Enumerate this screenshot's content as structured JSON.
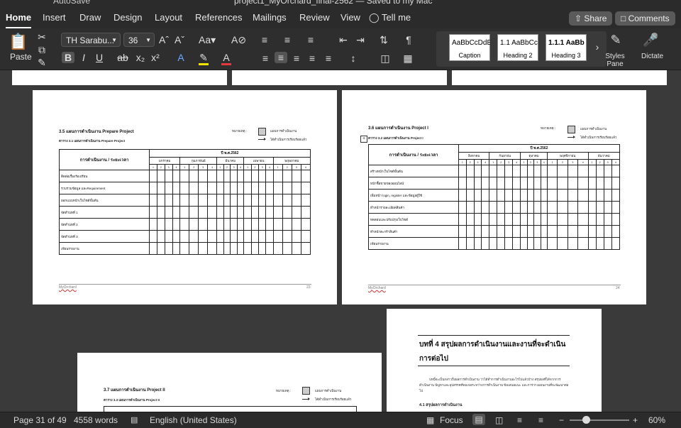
{
  "window": {
    "autosave_label": "AutoSave",
    "doc_title": "project1_MyOrchard_final-2562",
    "save_state": "— Saved to my Mac"
  },
  "tabs": [
    "Home",
    "Insert",
    "Draw",
    "Design",
    "Layout",
    "References",
    "Mailings",
    "Review",
    "View"
  ],
  "tell_me": "Tell me",
  "share_label": "Share",
  "comments_label": "Comments",
  "ribbon": {
    "paste_label": "Paste",
    "font_name": "TH Sarabu...",
    "font_size": "36",
    "styles": [
      {
        "sample": "AaBbCcDdEe",
        "name": "Caption"
      },
      {
        "sample": "1.1  AaBbCc",
        "name": "Heading 2"
      },
      {
        "sample": "1.1.1  AaBb",
        "name": "Heading 3"
      }
    ],
    "styles_pane_label": "Styles Pane",
    "dictate_label": "Dictate"
  },
  "pages": {
    "left": {
      "section_title": "3.5  แผนการดำเนินงาน Prepare Project",
      "caption": "ตาราง 3.1 แผนการดำเนินงาน Prepare Project",
      "legend_note": "หมายเหตุ :",
      "legend_plan": "แผนการดำเนินงาน",
      "legend_done": "ได้ดำเนินการเรียบร้อยแล้ว",
      "header_task": "การดำเนินงาน / ระยะเวลา",
      "header_year": "ปี พ.ศ.2562",
      "months": [
        "มกราคม",
        "กุมภาพันธ์",
        "มีนาคม",
        "เมษายน",
        "พฤษภาคม"
      ],
      "rows": [
        "ติดต่อเรื่องร้องเรียน",
        "รวบรวมข้อมูล และRequirement",
        "ออกแบบหน้าเว็บไซต์ขั้นต้น",
        "จัดทำบทที่ 1",
        "จัดทำบทที่ 2",
        "จัดทำบทที่ 3",
        "เขียนรายงาน"
      ],
      "footer_left": "MyOrchard",
      "footer_right": "23"
    },
    "right": {
      "section_title": "3.6  แผนการดำเนินงาน Project I",
      "caption": "ตาราง 3.2 แผนการดำเนินงาน Project I",
      "legend_note": "หมายเหตุ :",
      "legend_plan": "แผนการดำเนินงาน",
      "legend_done": "ได้ดำเนินการเรียบร้อยแล้ว",
      "header_task": "การดำเนินงาน / ระยะเวลา",
      "header_year": "ปี พ.ศ.2562",
      "months": [
        "สิงหาคม",
        "กันยายน",
        "ตุลาคม",
        "พฤศจิกายน",
        "ธันวาคม"
      ],
      "rows": [
        "สร้างหน้าเว็บไซต์ขั้นต้น",
        "หน้าซื้อขายของออนไลน์",
        "เพิ่มหน้า login, register และข้อมูลผู้ใช้",
        "ทำหน้ารายละเอียดสินค้า",
        "ทดสอบและปรับปรุงเว็บไซต์",
        "ทำหน้าตะกร้าสินค้า",
        "เขียนรายงาน"
      ],
      "footer_left": "MyOrchard",
      "footer_right": "24"
    },
    "bottom_left": {
      "section_title": "3.7     แผนการดำเนินงาน Project II",
      "caption": "ตาราง 3.3 แผนการดำเนินงาน Project II",
      "legend_note": "หมายเหตุ :",
      "legend_plan": "แผนการดำเนินงาน",
      "legend_done": "ได้ดำเนินการเรียบร้อยแล้ว"
    },
    "bottom_right": {
      "chapter_title": "บทที่ 4  สรุปผลการดำเนินงานและงานที่จะดำเนินการต่อไป",
      "paragraph": "บทนี้จะเป็นกล่าวถึงผลการดำเนินงาน ว่าได้ทำการดำเนินงานอะไรไปแล้วบ้าง สรุปผลที่ได้จากการดำเนินงาน ปัญหาและอุปสรรคที่พบเจอระหว่างการดำเนินงาน ข้อเสนอแนะ และการวางแผนงานที่จะพัฒนาต่อไป",
      "subsection": "4.1  สรุปผลการดำเนินงาน"
    }
  },
  "status_bar": {
    "page": "Page 31 of 49",
    "words": "4558 words",
    "language": "English (United States)",
    "focus": "Focus",
    "zoom": "60%"
  }
}
